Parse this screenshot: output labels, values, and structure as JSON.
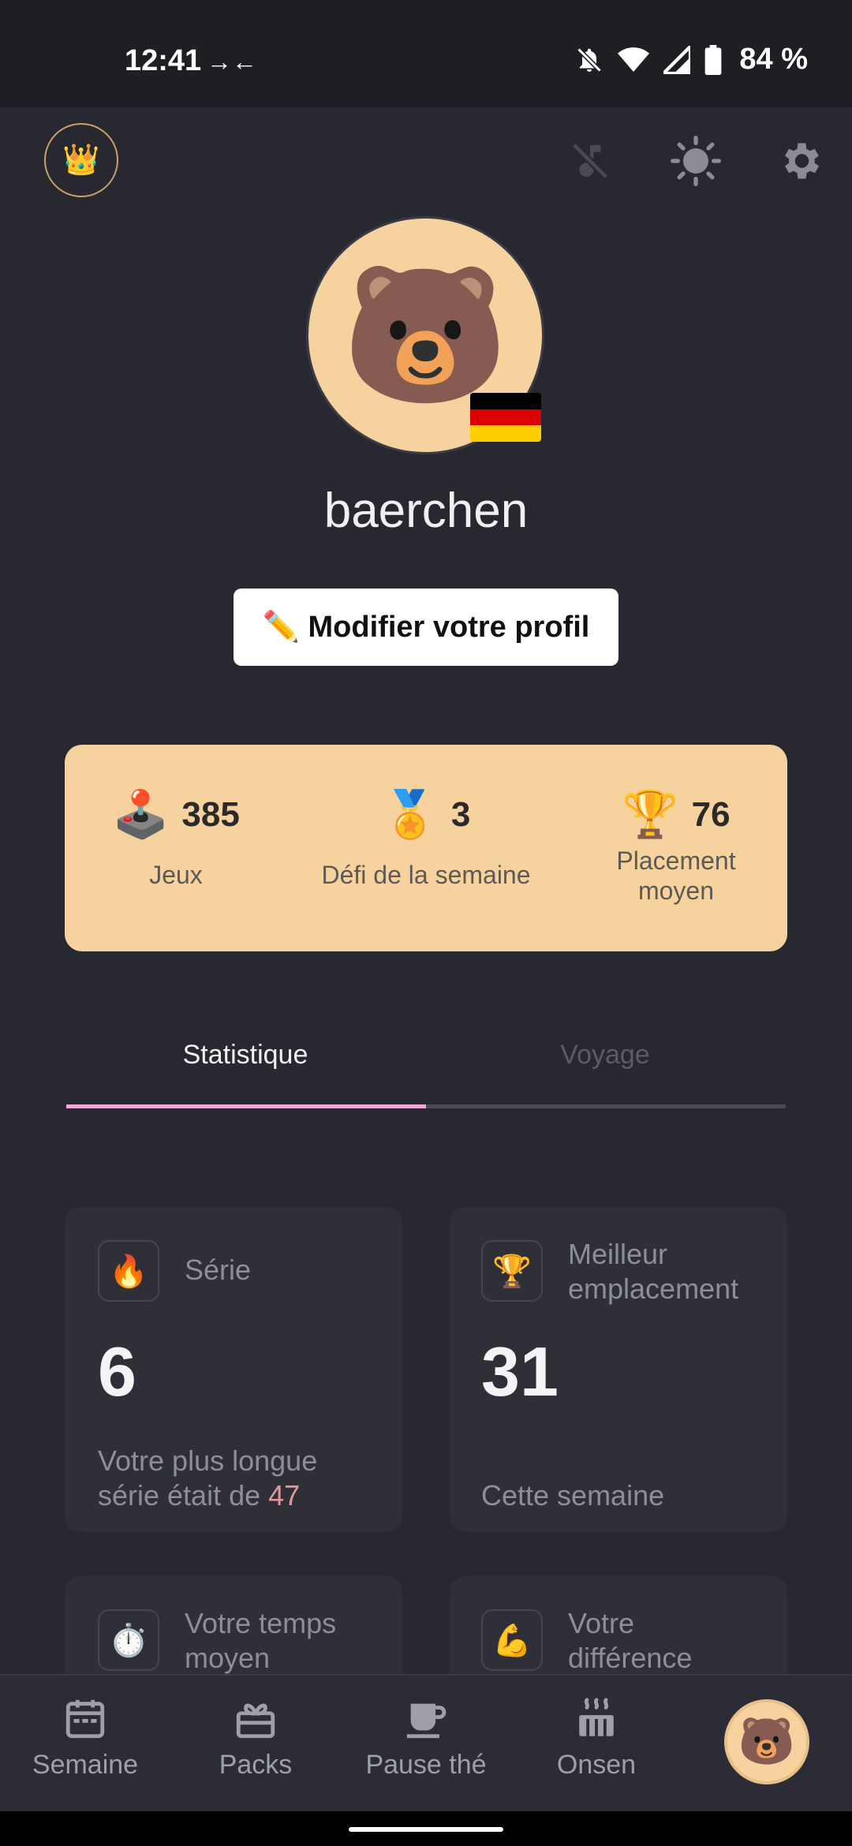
{
  "status_bar": {
    "time": "12:41",
    "battery": "84 %",
    "icons": [
      "data-saver-arrows-icon",
      "bell-off-icon",
      "wifi-icon",
      "signal-icon",
      "battery-icon"
    ]
  },
  "top_bar": {
    "icons": [
      "crown-icon",
      "music-off-icon",
      "brightness-icon",
      "gear-icon"
    ]
  },
  "profile": {
    "avatar": "🐻",
    "flag": "germany-flag",
    "username": "baerchen",
    "edit_button": "✏️ Modifier votre profil"
  },
  "stats": [
    {
      "emoji": "🕹️",
      "value": "385",
      "label": "Jeux"
    },
    {
      "emoji": "🏅",
      "value": "3",
      "label": "Défi de la semaine"
    },
    {
      "emoji": "🏆",
      "value": "76",
      "label": "Placement moyen"
    }
  ],
  "tabs": [
    {
      "label": "Statistique",
      "active": true
    },
    {
      "label": "Voyage",
      "active": false
    }
  ],
  "tiles": [
    {
      "icon": "🔥",
      "title": "Série",
      "value": "6",
      "subtitle_prefix": "Votre plus longue série était de ",
      "subtitle_accent": "47"
    },
    {
      "icon": "🏆",
      "title": "Meilleur emplacement",
      "value": "31",
      "subtitle": "Cette semaine"
    },
    {
      "icon": "⏱️",
      "title": "Votre temps moyen"
    },
    {
      "icon": "💪",
      "title": "Votre différence"
    }
  ],
  "bottom_nav": [
    {
      "label": "Semaine",
      "icon": "calendar-icon"
    },
    {
      "label": "Packs",
      "icon": "gift-box-icon"
    },
    {
      "label": "Pause thé",
      "icon": "tea-cup-icon"
    },
    {
      "label": "Onsen",
      "icon": "onsen-icon"
    }
  ],
  "nav_avatar": "🐻",
  "colors": {
    "background": "#272830",
    "card": "#f6d29e",
    "tab_active": "#f0a8d8",
    "accent": "#e8959a"
  }
}
